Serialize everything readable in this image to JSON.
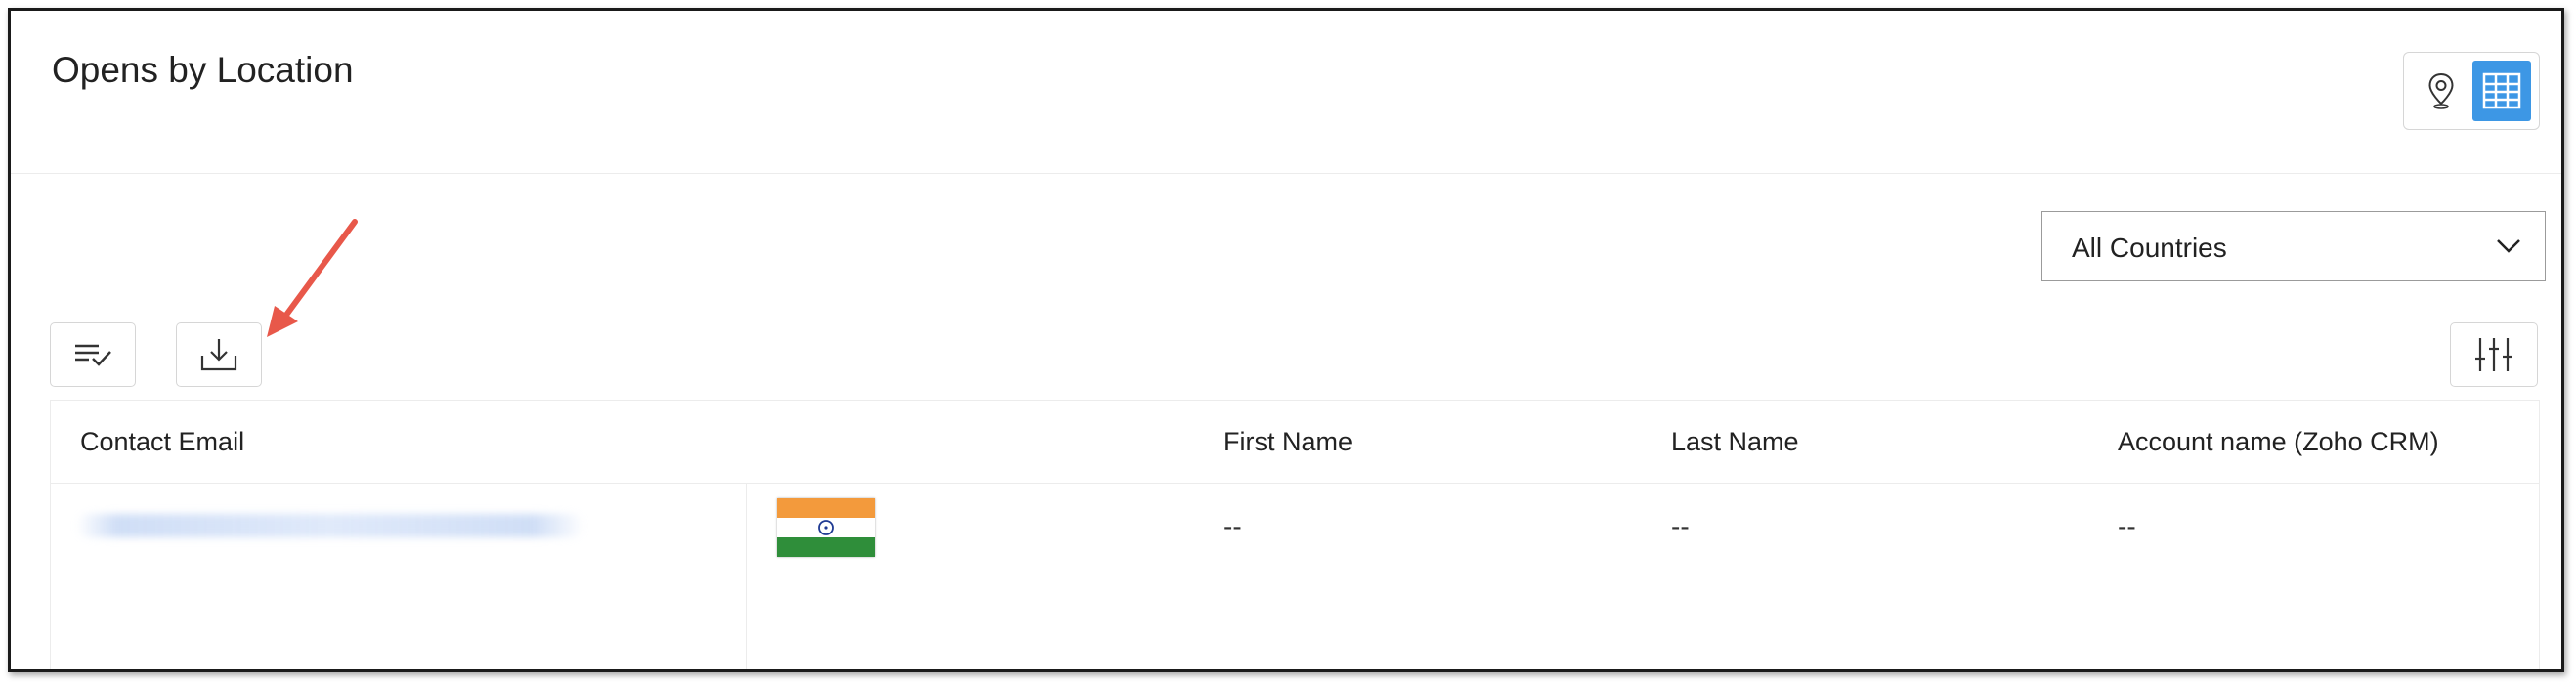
{
  "panel": {
    "title": "Opens by Location"
  },
  "view_toggle": {
    "map_icon": "map-pin-icon",
    "table_icon": "table-grid-icon",
    "active": "table"
  },
  "filter": {
    "selected_country": "All Countries"
  },
  "toolbar": {
    "select_icon": "list-check-icon",
    "download_icon": "download-icon",
    "columns_icon": "sliders-icon"
  },
  "table": {
    "columns": [
      "Contact Email",
      "First Name",
      "Last Name",
      "Account name (Zoho CRM)"
    ],
    "rows": [
      {
        "country_flag": "india-flag",
        "first_name": "--",
        "last_name": "--",
        "account_name": "--"
      }
    ]
  },
  "colors": {
    "accent": "#3d97e5",
    "annotation_arrow": "#e8584a"
  }
}
